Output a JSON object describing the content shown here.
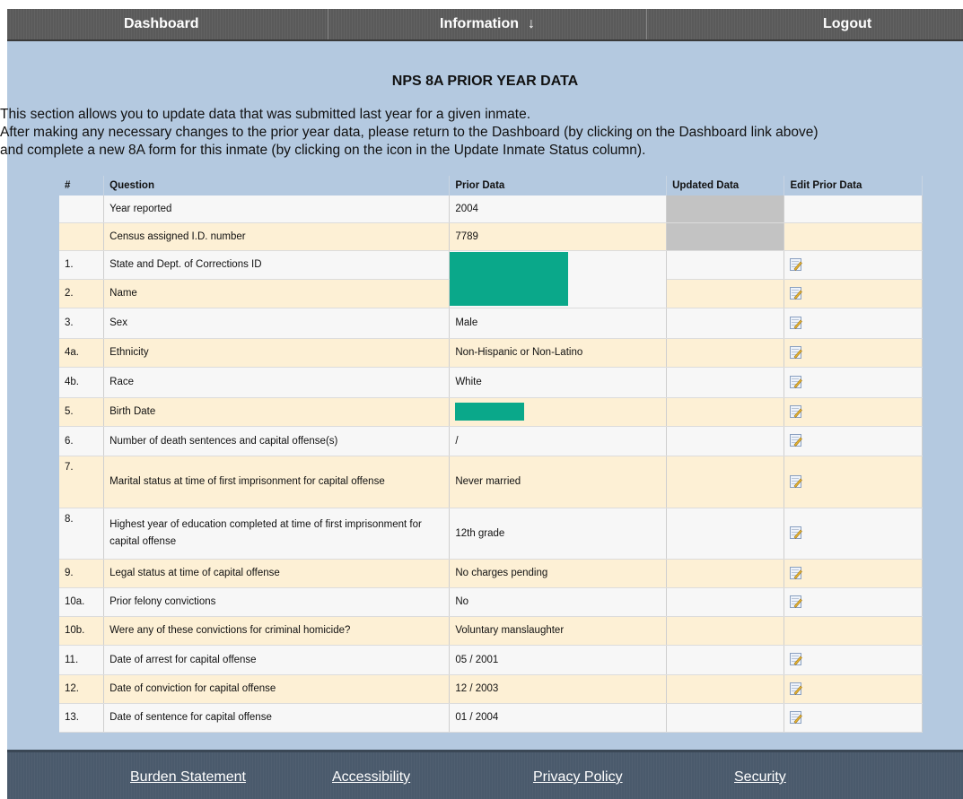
{
  "nav": {
    "dashboard": "Dashboard",
    "information": "Information",
    "information_arrow": "↓",
    "logout": "Logout"
  },
  "page_title": "NPS 8A PRIOR YEAR DATA",
  "intro": {
    "line1": "This section allows you to update data that was submitted last year for a given inmate.",
    "line2": "After making any necessary changes to the prior year data, please return to the Dashboard (by clicking on the Dashboard link above)",
    "line3": "and complete a new 8A form for this inmate (by clicking on the icon in the Update Inmate Status column)."
  },
  "table": {
    "headers": [
      "#",
      "Question",
      "Prior Data",
      "Updated Data",
      "Edit Prior Data"
    ],
    "rows": [
      {
        "num": "",
        "question": "Year reported",
        "prior": "2004"
      },
      {
        "num": "",
        "question": "Census assigned I.D. number",
        "prior": "7789"
      },
      {
        "num": "1.",
        "question": "State and Dept. of Corrections ID",
        "prior": ""
      },
      {
        "num": "2.",
        "question": "Name",
        "prior": ""
      },
      {
        "num": "3.",
        "question": "Sex",
        "prior": "Male"
      },
      {
        "num": "4a.",
        "question": "Ethnicity",
        "prior": "Non-Hispanic or Non-Latino"
      },
      {
        "num": "4b.",
        "question": "Race",
        "prior": "White"
      },
      {
        "num": "5.",
        "question": "Birth Date",
        "prior": ""
      },
      {
        "num": "6.",
        "question": "Number of death sentences and capital offense(s)",
        "prior": "/"
      },
      {
        "num": "7.",
        "question": "Marital status at time of first imprisonment for capital offense",
        "prior": "Never married"
      },
      {
        "num": "8.",
        "question": "Highest year of education completed at time of first imprisonment for capital offense",
        "prior": "12th grade"
      },
      {
        "num": "9.",
        "question": "Legal status at time of capital offense",
        "prior": "No charges pending"
      },
      {
        "num": "10a.",
        "question": "Prior felony convictions",
        "prior": "No"
      },
      {
        "num": "10b.",
        "question": "Were any of these convictions for criminal homicide?",
        "prior": "Voluntary manslaughter"
      },
      {
        "num": "11.",
        "question": "Date of arrest for capital offense",
        "prior": "05 / 2001"
      },
      {
        "num": "12.",
        "question": "Date of conviction for capital offense",
        "prior": "12 / 2003"
      },
      {
        "num": "13.",
        "question": "Date of sentence for capital offense",
        "prior": "01 / 2004"
      }
    ]
  },
  "footer": {
    "burden": "Burden Statement",
    "accessibility": "Accessibility",
    "privacy": "Privacy Policy",
    "security": "Security"
  },
  "colors": {
    "page_bg": "#b4c9e0",
    "row_odd": "#f7f7f7",
    "row_even": "#fdf0d5",
    "redaction": "#0aa88a",
    "nav_bg": "#5a5a5a",
    "footer_bg": "#4a5a6c"
  }
}
